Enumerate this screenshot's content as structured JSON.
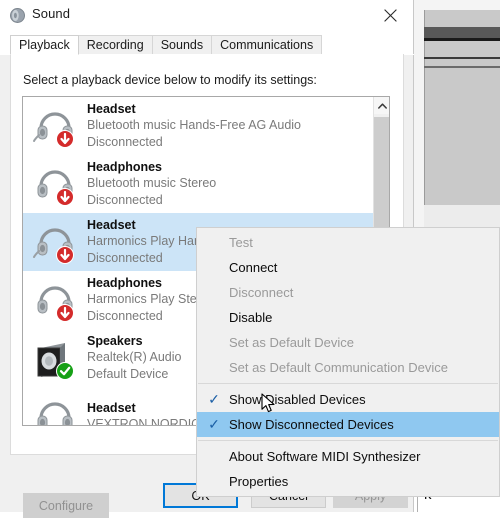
{
  "window": {
    "title": "Sound",
    "icon": "speaker-icon",
    "close_label": "×"
  },
  "tabs": [
    {
      "label": "Playback",
      "active": true
    },
    {
      "label": "Recording",
      "active": false
    },
    {
      "label": "Sounds",
      "active": false
    },
    {
      "label": "Communications",
      "active": false
    }
  ],
  "playback": {
    "instruction": "Select a playback device below to modify its settings:",
    "devices": [
      {
        "name": "Headset",
        "description": "Bluetooth music Hands-Free AG Audio",
        "status": "Disconnected",
        "icon": "headset-icon",
        "badge": "disconnected-badge",
        "selected": false
      },
      {
        "name": "Headphones",
        "description": "Bluetooth music Stereo",
        "status": "Disconnected",
        "icon": "headphones-icon",
        "badge": "disconnected-badge",
        "selected": false
      },
      {
        "name": "Headset",
        "description": "Harmonics Play Hands",
        "status": "Disconnected",
        "icon": "headset-icon",
        "badge": "disconnected-badge",
        "selected": true
      },
      {
        "name": "Headphones",
        "description": "Harmonics Play Stereo",
        "status": "Disconnected",
        "icon": "headphones-icon",
        "badge": "disconnected-badge",
        "selected": false
      },
      {
        "name": "Speakers",
        "description": "Realtek(R) Audio",
        "status": "Default Device",
        "icon": "speakers-icon",
        "badge": "default-badge",
        "selected": false
      },
      {
        "name": "Headset",
        "description": "VEXTRON NORDIC Ha",
        "status": "",
        "icon": "headset-icon",
        "badge": "none",
        "selected": false
      }
    ],
    "configure_label": "Configure"
  },
  "context_menu": {
    "items": [
      {
        "label": "Test",
        "enabled": false,
        "checked": false,
        "highlighted": false
      },
      {
        "label": "Connect",
        "enabled": true,
        "checked": false,
        "highlighted": false
      },
      {
        "label": "Disconnect",
        "enabled": false,
        "checked": false,
        "highlighted": false
      },
      {
        "label": "Disable",
        "enabled": true,
        "checked": false,
        "highlighted": false
      },
      {
        "label": "Set as Default Device",
        "enabled": false,
        "checked": false,
        "highlighted": false
      },
      {
        "label": "Set as Default Communication Device",
        "enabled": false,
        "checked": false,
        "highlighted": false
      },
      {
        "separator": true
      },
      {
        "label": "Show Disabled Devices",
        "enabled": true,
        "checked": true,
        "highlighted": false
      },
      {
        "label": "Show Disconnected Devices",
        "enabled": true,
        "checked": true,
        "highlighted": true
      },
      {
        "separator": true
      },
      {
        "label": "About Software MIDI Synthesizer",
        "enabled": true,
        "checked": false,
        "highlighted": false
      },
      {
        "label": "Properties",
        "enabled": true,
        "checked": false,
        "highlighted": false
      }
    ]
  },
  "dialog_buttons": {
    "ok": "OK",
    "cancel": "Cancel",
    "apply": "Apply"
  },
  "background": {
    "stray_glyph": "k"
  },
  "colors": {
    "selection_blue": "#cce4f7",
    "menu_highlight": "#8fc8f0",
    "focus_border": "#0078d7",
    "disconnected_red": "#d42b2b",
    "default_green": "#16a016",
    "logo_cyan": "#00d8f5",
    "logo_blue": "#0b3fd4"
  }
}
